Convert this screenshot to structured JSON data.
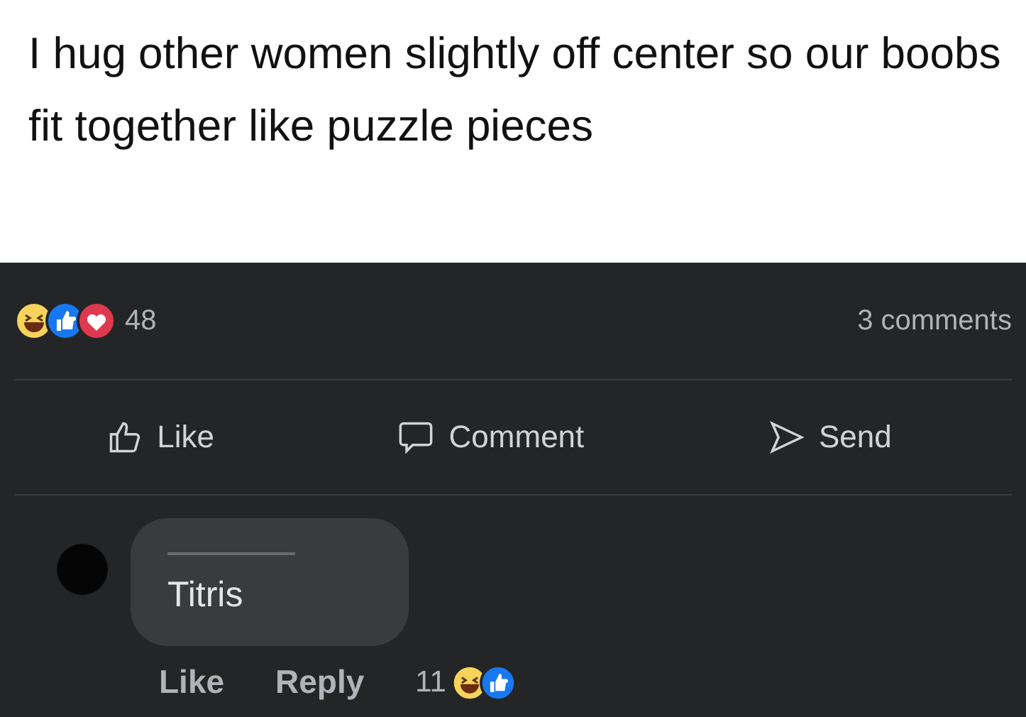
{
  "post": {
    "text": "I hug other women slightly off center so our boobs fit together like puzzle pieces"
  },
  "reactions": {
    "icons": [
      {
        "kind": "haha"
      },
      {
        "kind": "like"
      },
      {
        "kind": "love"
      }
    ],
    "count": "48",
    "comments": "3 comments"
  },
  "actions": [
    {
      "kind": "like",
      "label": "Like"
    },
    {
      "kind": "comment",
      "label": "Comment"
    },
    {
      "kind": "send",
      "label": "Send"
    }
  ],
  "comment": {
    "text": "Titris",
    "actions": [
      "Like",
      "Reply"
    ],
    "reaction_count": "11",
    "reactions": [
      {
        "kind": "haha"
      },
      {
        "kind": "like"
      }
    ]
  }
}
